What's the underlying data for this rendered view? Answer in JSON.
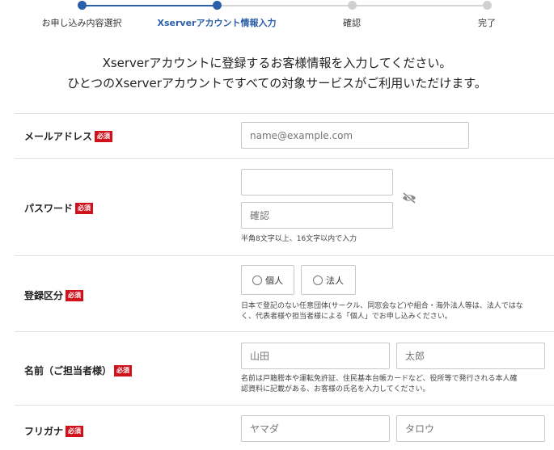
{
  "steps": [
    {
      "label": "お申し込み内容選択",
      "state": "done"
    },
    {
      "label": "Xserverアカウント情報入力",
      "state": "active"
    },
    {
      "label": "確認",
      "state": "todo"
    },
    {
      "label": "完了",
      "state": "todo"
    }
  ],
  "intro": {
    "line1": "Xserverアカウントに登録するお客様情報を入力してください。",
    "line2": "ひとつのXserverアカウントですべての対象サービスがご利用いただけます。"
  },
  "required_badge": "必須",
  "email": {
    "label": "メールアドレス",
    "placeholder": "name@example.com"
  },
  "password": {
    "label": "パスワード",
    "value": "",
    "confirm_placeholder": "確認",
    "hint": "半角8文字以上、16文字以内で入力"
  },
  "registration": {
    "label": "登録区分",
    "options": [
      "個人",
      "法人"
    ],
    "hint1": "日本で登記のない任意団体(サークル、同窓会など)や組合・海外法人等は、法人ではな",
    "hint2": "く、代表者様や担当者様による「個人」でお申し込みください。"
  },
  "name": {
    "label": "名前（ご担当者様）",
    "last_placeholder": "山田",
    "first_placeholder": "太郎",
    "hint1": "名前は戸籍謄本や運転免許証、住民基本台帳カードなど、役所等で発行される本人確",
    "hint2": "認資料に記載がある、お客様の氏名を入力してください。"
  },
  "furigana": {
    "label": "フリガナ",
    "last_placeholder": "ヤマダ",
    "first_placeholder": "タロウ"
  },
  "colors": {
    "accent": "#2b5ea8",
    "required": "#d0121b"
  }
}
